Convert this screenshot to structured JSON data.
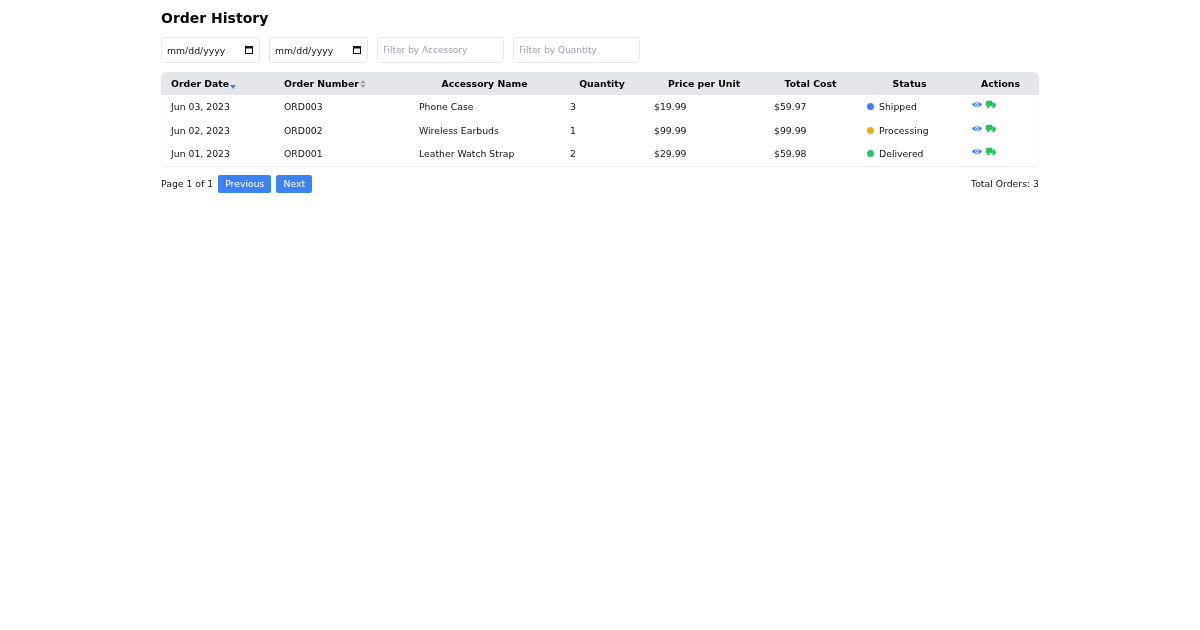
{
  "title": "Order History",
  "filters": [
    {
      "kind": "date",
      "placeholder": "mm/dd/yyyy"
    },
    {
      "kind": "date",
      "placeholder": "mm/dd/yyyy"
    },
    {
      "kind": "text",
      "placeholder": "Filter by Accessory"
    },
    {
      "kind": "text",
      "placeholder": "Filter by Quantity"
    }
  ],
  "table": {
    "columns": [
      {
        "label": "Order Date",
        "kind": "sortable",
        "sorted": true
      },
      {
        "label": "Order Number",
        "kind": "sortable",
        "sorted": false
      },
      {
        "label": "Accessory Name",
        "kind": "plain"
      },
      {
        "label": "Quantity",
        "kind": "plain"
      },
      {
        "label": "Price per Unit",
        "kind": "plain"
      },
      {
        "label": "Total Cost",
        "kind": "plain"
      },
      {
        "label": "Status",
        "kind": "plain"
      },
      {
        "label": "Actions",
        "kind": "plain"
      }
    ],
    "rows": [
      {
        "order_date": "Jun 03, 2023",
        "order_number": "ORD003",
        "accessory_name": "Phone Case",
        "quantity": "3",
        "price_per_unit": "$19.99",
        "total_cost": "$59.97",
        "status": {
          "label": "Shipped",
          "color": "#3b82f6"
        }
      },
      {
        "order_date": "Jun 02, 2023",
        "order_number": "ORD002",
        "accessory_name": "Wireless Earbuds",
        "quantity": "1",
        "price_per_unit": "$99.99",
        "total_cost": "$99.99",
        "status": {
          "label": "Processing",
          "color": "#eab308"
        }
      },
      {
        "order_date": "Jun 01, 2023",
        "order_number": "ORD001",
        "accessory_name": "Leather Watch Strap",
        "quantity": "2",
        "price_per_unit": "$29.99",
        "total_cost": "$59.98",
        "status": {
          "label": "Delivered",
          "color": "#22c55e"
        }
      }
    ]
  },
  "pagination": {
    "page_info": "Page 1 of 1",
    "buttons": [
      "Previous",
      "Next"
    ]
  },
  "total_orders": "Total Orders: 3"
}
